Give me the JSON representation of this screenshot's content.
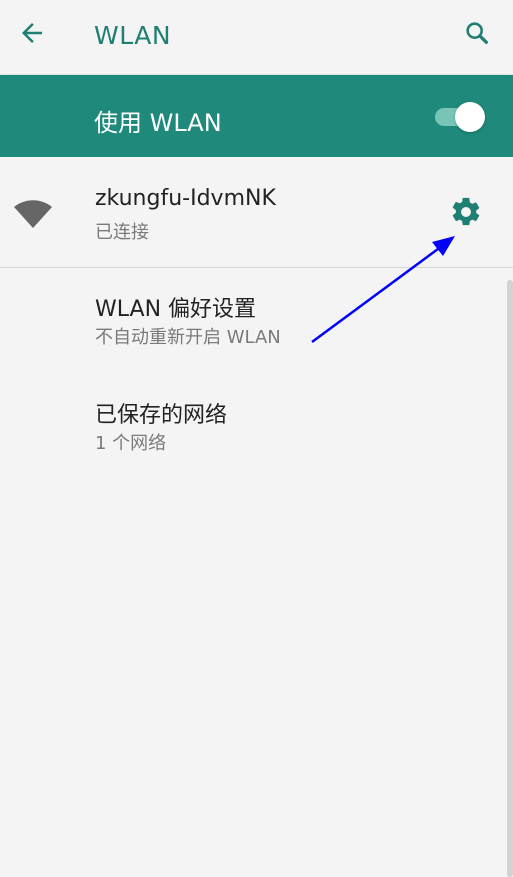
{
  "header": {
    "title": "WLAN",
    "back_icon": "back-arrow-icon",
    "search_icon": "search-icon"
  },
  "wlan_toggle": {
    "label": "使用 WLAN",
    "state": "on"
  },
  "connected_network": {
    "name": "zkungfu-IdvmNK",
    "status": "已连接",
    "icon": "wifi-signal-icon",
    "settings_icon": "gear-icon"
  },
  "preferences": {
    "title": "WLAN 偏好设置",
    "subtitle": "不自动重新开启 WLAN"
  },
  "saved_networks": {
    "title": "已保存的网络",
    "subtitle": "1 个网络"
  },
  "colors": {
    "teal": "#1f8a7b",
    "teal_text": "#1f7f72",
    "background": "#f4f4f4",
    "switch_track": "#78c5b8",
    "annotation_arrow": "#0000ff"
  }
}
